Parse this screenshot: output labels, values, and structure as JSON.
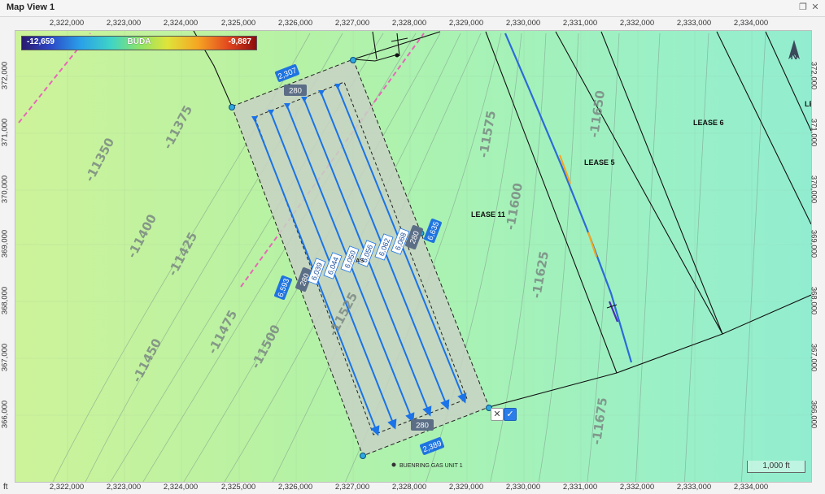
{
  "window": {
    "title": "Map View 1",
    "restore_icon": "restore-window-icon",
    "close_icon": "close-icon"
  },
  "axes": {
    "unit": "ft",
    "x_ticks": [
      "2,322,000",
      "2,323,000",
      "2,324,000",
      "2,325,000",
      "2,326,000",
      "2,327,000",
      "2,328,000",
      "2,329,000",
      "2,330,000",
      "2,331,000",
      "2,332,000",
      "2,333,000",
      "2,334,000"
    ],
    "y_ticks": [
      "372,000",
      "371,000",
      "370,000",
      "369,000",
      "368,000",
      "367,000",
      "366,000"
    ]
  },
  "legend": {
    "min": "-12,659",
    "name": "BUDA",
    "max": "-9,887"
  },
  "contours": [
    "-11350",
    "-11375",
    "-11400",
    "-11425",
    "-11450",
    "-11475",
    "-11500",
    "-11525",
    "-11575",
    "-11600",
    "-11625",
    "-11650",
    "-11675"
  ],
  "leases": [
    "LEASE 11",
    "LEASE 5",
    "LEASE 6",
    "LE"
  ],
  "unit_label": "BUENRING GAS UNIT 1",
  "unit_label_partial": "AS",
  "dimensions": {
    "top": "2,307",
    "left": "6,593",
    "right": "6,635",
    "bottom": "2,389",
    "setback_top": "280",
    "setback_left": "280",
    "setback_right": "280",
    "setback_bottom": "280"
  },
  "laterals": [
    "6,039",
    "6,044",
    "6,050",
    "6,056",
    "6,062",
    "6,068"
  ],
  "scale_bar": "1,000 ft",
  "north_label": "N",
  "colors": {
    "boundary_fill": "#c8d2c4",
    "lateral": "#1a73e8",
    "badge": "#1f74e0",
    "setback_badge": "#5b6e86",
    "dashed_line": "#e668b8"
  }
}
